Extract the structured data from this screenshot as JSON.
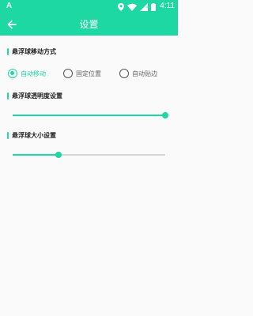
{
  "status_bar": {
    "notification": "A",
    "time": "4:11",
    "icons": [
      "location-icon",
      "wifi-icon",
      "signal-icon",
      "battery-icon"
    ]
  },
  "app_bar": {
    "title": "设置",
    "back_icon": "arrow-left-icon"
  },
  "sections": {
    "move_mode": {
      "title": "悬浮球移动方式",
      "options": [
        {
          "label": "自动移动",
          "checked": true
        },
        {
          "label": "固定位置",
          "checked": false
        },
        {
          "label": "自动贴边",
          "checked": false
        }
      ]
    },
    "opacity": {
      "title": "悬浮球透明度设置",
      "value_percent": 100
    },
    "size": {
      "title": "悬浮球大小设置",
      "value_percent": 30
    }
  },
  "colors": {
    "accent": "#1ed8a4",
    "background": "#fafafa",
    "track": "#d6d6d6"
  }
}
